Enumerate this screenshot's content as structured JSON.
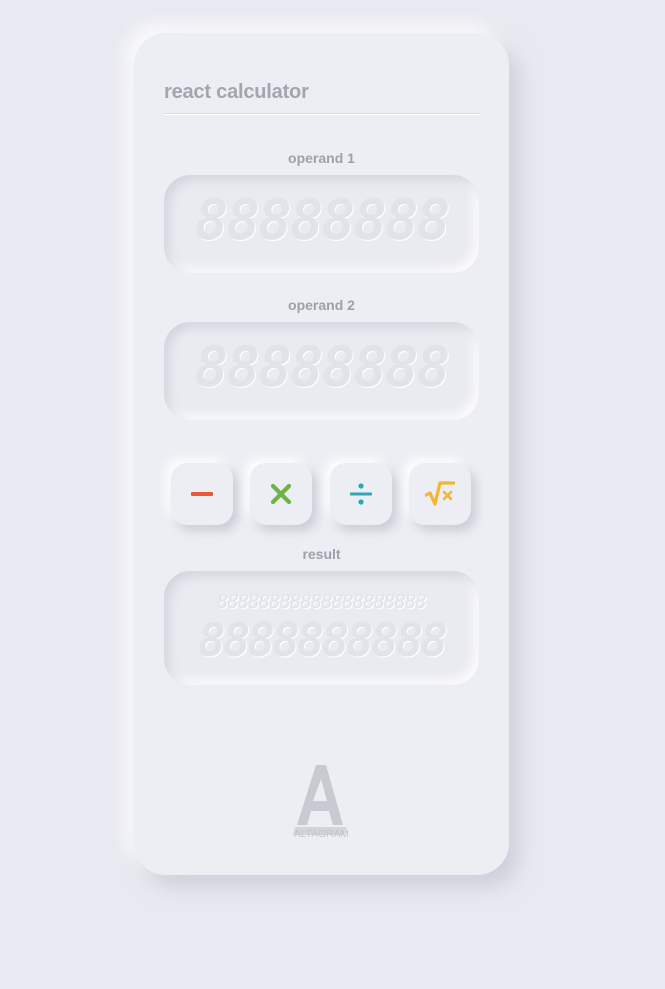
{
  "app": {
    "title": "react calculator"
  },
  "operand1": {
    "label": "operand 1",
    "display": "88888888"
  },
  "operand2": {
    "label": "operand 2",
    "display": "88888888"
  },
  "operations": [
    {
      "name": "subtract",
      "icon": "minus-icon",
      "color": "#e8593c"
    },
    {
      "name": "multiply",
      "icon": "times-icon",
      "color": "#6fb24a"
    },
    {
      "name": "divide",
      "icon": "divide-icon",
      "color": "#2aa9b7"
    },
    {
      "name": "square-root",
      "icon": "sqrt-icon",
      "color": "#f2b630"
    }
  ],
  "result": {
    "label": "result",
    "display_top": "88888888888888888888",
    "display_main": "8888888888"
  },
  "brand": {
    "logo": "altagram-logo",
    "text": "ALTAGRAM"
  }
}
